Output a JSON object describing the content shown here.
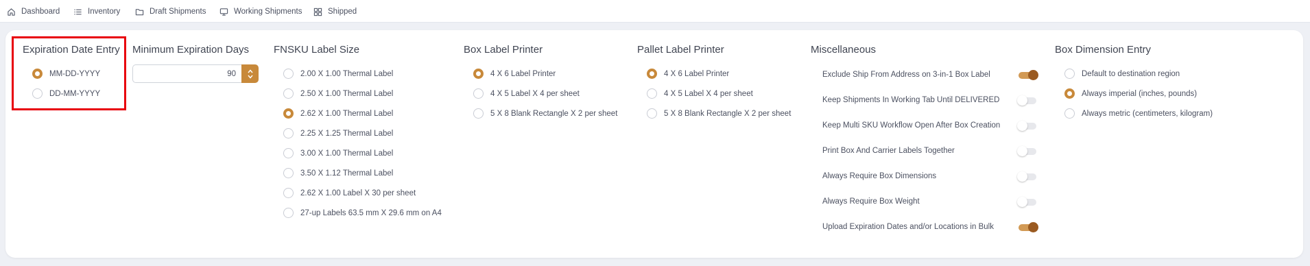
{
  "nav": {
    "items": [
      {
        "label": "Dashboard",
        "icon": "home-icon"
      },
      {
        "label": "Inventory",
        "icon": "list-icon"
      },
      {
        "label": "Draft Shipments",
        "icon": "folder-icon"
      },
      {
        "label": "Working Shipments",
        "icon": "monitor-icon"
      },
      {
        "label": "Shipped",
        "icon": "grid-icon"
      }
    ]
  },
  "expiration": {
    "title": "Expiration Date Entry",
    "options": [
      {
        "label": "MM-DD-YYYY",
        "selected": true
      },
      {
        "label": "DD-MM-YYYY",
        "selected": false
      }
    ]
  },
  "min_days": {
    "title": "Minimum Expiration Days",
    "value": "90"
  },
  "fnsku": {
    "title": "FNSKU Label Size",
    "options": [
      {
        "label": "2.00 X 1.00 Thermal Label",
        "selected": false
      },
      {
        "label": "2.50 X 1.00 Thermal Label",
        "selected": false
      },
      {
        "label": "2.62 X 1.00 Thermal Label",
        "selected": true
      },
      {
        "label": "2.25 X 1.25 Thermal Label",
        "selected": false
      },
      {
        "label": "3.00 X 1.00 Thermal Label",
        "selected": false
      },
      {
        "label": "3.50 X 1.12 Thermal Label",
        "selected": false
      },
      {
        "label": "2.62 X 1.00 Label X 30 per sheet",
        "selected": false
      },
      {
        "label": "27-up Labels 63.5 mm X 29.6 mm on A4",
        "selected": false
      }
    ]
  },
  "box_printer": {
    "title": "Box Label Printer",
    "options": [
      {
        "label": "4 X 6 Label Printer",
        "selected": true
      },
      {
        "label": "4 X 5 Label X 4 per sheet",
        "selected": false
      },
      {
        "label": "5 X 8 Blank Rectangle X 2 per sheet",
        "selected": false
      }
    ]
  },
  "pallet_printer": {
    "title": "Pallet Label Printer",
    "options": [
      {
        "label": "4 X 6 Label Printer",
        "selected": true
      },
      {
        "label": "4 X 5 Label X 4 per sheet",
        "selected": false
      },
      {
        "label": "5 X 8 Blank Rectangle X 2 per sheet",
        "selected": false
      }
    ]
  },
  "misc": {
    "title": "Miscellaneous",
    "toggles": [
      {
        "label": "Exclude Ship From Address on 3-in-1 Box Label",
        "on": true
      },
      {
        "label": "Keep Shipments In Working Tab Until DELIVERED",
        "on": false
      },
      {
        "label": "Keep Multi SKU Workflow Open After Box Creation",
        "on": false
      },
      {
        "label": "Print Box And Carrier Labels Together",
        "on": false
      },
      {
        "label": "Always Require Box Dimensions",
        "on": false
      },
      {
        "label": "Always Require Box Weight",
        "on": false
      },
      {
        "label": "Upload Expiration Dates and/or Locations in Bulk",
        "on": true
      }
    ]
  },
  "box_dimension": {
    "title": "Box Dimension Entry",
    "options": [
      {
        "label": "Default to destination region",
        "selected": false
      },
      {
        "label": "Always imperial (inches, pounds)",
        "selected": true
      },
      {
        "label": "Always metric (centimeters, kilogram)",
        "selected": false
      }
    ]
  },
  "colors": {
    "accent": "#c8893a",
    "toggle_on_track": "#d29a55",
    "toggle_on_knob": "#9a5a21",
    "highlight": "#e8000b"
  }
}
